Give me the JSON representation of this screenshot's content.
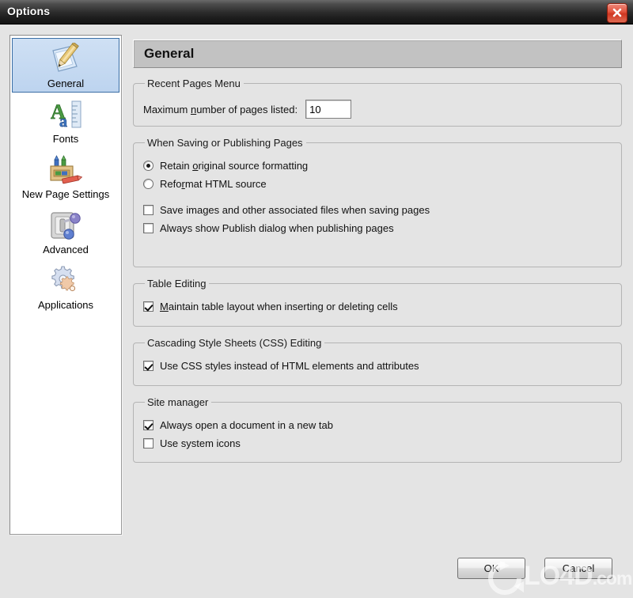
{
  "window": {
    "title": "Options",
    "close_icon": "close-icon"
  },
  "sidebar": {
    "items": [
      {
        "label": "General",
        "icon": "document-pencil-icon",
        "selected": true
      },
      {
        "label": "Fonts",
        "icon": "fonts-ruler-icon",
        "selected": false
      },
      {
        "label": "New Page Settings",
        "icon": "crayon-box-icon",
        "selected": false
      },
      {
        "label": "Advanced",
        "icon": "toggle-switch-icon",
        "selected": false
      },
      {
        "label": "Applications",
        "icon": "gears-icon",
        "selected": false
      }
    ]
  },
  "main": {
    "page_title": "General",
    "groups": [
      {
        "legend": "Recent Pages Menu",
        "field": {
          "label_before": "Maximum ",
          "label_accel": "n",
          "label_after": "umber of pages listed:",
          "value": "10"
        }
      },
      {
        "legend": "When Saving or Publishing Pages",
        "options": [
          {
            "type": "radio",
            "checked": true,
            "before": "Retain ",
            "accel": "o",
            "after": "riginal source formatting"
          },
          {
            "type": "radio",
            "checked": false,
            "before": "Refo",
            "accel": "r",
            "after": "mat HTML source"
          },
          {
            "type": "checkbox",
            "checked": false,
            "before": "Save images and other associated files when saving pages",
            "accel": "",
            "after": ""
          },
          {
            "type": "checkbox",
            "checked": false,
            "before": "Always show Publish dialog when publishing pages",
            "accel": "",
            "after": ""
          }
        ]
      },
      {
        "legend": "Table Editing",
        "options": [
          {
            "type": "checkbox",
            "checked": true,
            "before": "",
            "accel": "M",
            "after": "aintain table layout when inserting or deleting cells"
          }
        ]
      },
      {
        "legend": "Cascading Style Sheets (CSS) Editing",
        "options": [
          {
            "type": "checkbox",
            "checked": true,
            "before": "Use CSS styles instead of HTML elements and attributes",
            "accel": "",
            "after": ""
          }
        ]
      },
      {
        "legend": "Site manager",
        "options": [
          {
            "type": "checkbox",
            "checked": true,
            "before": "Always open a document in a new tab",
            "accel": "",
            "after": ""
          },
          {
            "type": "checkbox",
            "checked": false,
            "before": "Use system icons",
            "accel": "",
            "after": ""
          }
        ]
      }
    ]
  },
  "footer": {
    "ok_label": "OK",
    "cancel_label": "Cancel"
  },
  "watermark": {
    "text": "LO4D",
    "suffix": ".com",
    "logo_icon": "refresh-circle-icon"
  },
  "colors": {
    "dialog_background": "#e4e4e4",
    "titlebar": "#1d1d1d",
    "close_button": "#cf3621",
    "selection": "#bdd4ef",
    "header_bar": "#c2c2c2"
  }
}
